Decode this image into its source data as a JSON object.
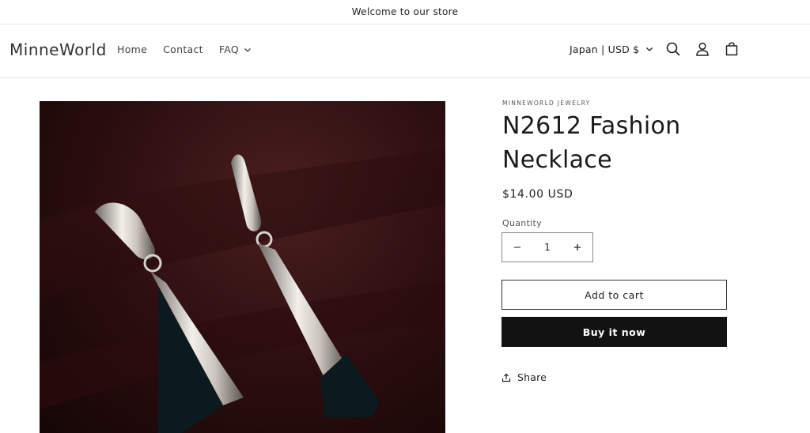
{
  "announcement": {
    "text": "Welcome to our store"
  },
  "header": {
    "logo": "MinneWorld",
    "nav": [
      {
        "label": "Home"
      },
      {
        "label": "Contact"
      },
      {
        "label": "FAQ"
      }
    ],
    "locale": "Japan | USD $",
    "icons": [
      "search-icon",
      "account-icon",
      "cart-icon"
    ]
  },
  "product": {
    "image": "drop-earrings-photo",
    "vendor": "MINNEWORLD JEWELRY",
    "title": "N2612 Fashion Necklace",
    "price": "$14.00 USD",
    "quantity_label": "Quantity",
    "quantity_value": "1",
    "add_to_cart": "Add to cart",
    "buy_now": "Buy it now",
    "share": "Share"
  },
  "colors": {
    "text": "#121212",
    "button_dark": "#121212",
    "image_bg": "#2a0d0e"
  }
}
